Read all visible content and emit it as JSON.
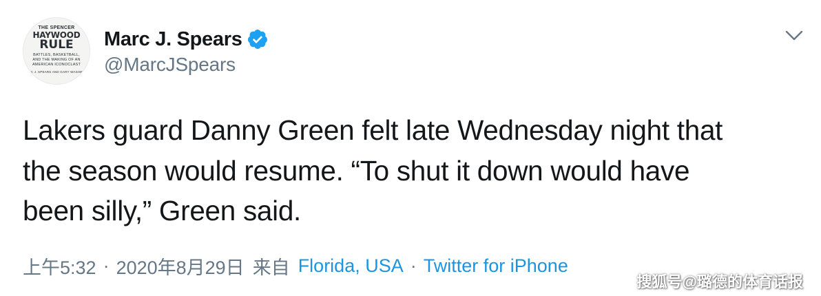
{
  "author": {
    "display_name": "Marc J. Spears",
    "handle": "@MarcJSpears",
    "verified": true,
    "avatar": {
      "line1": "THE SPENCER",
      "line2": "HAYWOOD",
      "line3": "RULE",
      "line4": "BATTLES, BASKETBALL,",
      "line5": "AND THE MAKING OF AN",
      "line6": "AMERICAN ICONOCLAST",
      "line7": "MARC J. SPEARS AND GARY WASHBURN"
    }
  },
  "tweet": {
    "line1": "Lakers guard Danny Green felt late Wednesday night that",
    "line2": "the season would resume. “To shut it down would have",
    "line3": "been silly,” Green said."
  },
  "meta": {
    "time": "上午5:32",
    "separator": "·",
    "date": "2020年8月29日",
    "from_label": "来自",
    "location": "Florida, USA",
    "source": "Twitter for iPhone"
  },
  "watermark": "搜狐号@璐德的体育话报",
  "icons": {
    "verified": "verified-badge-icon",
    "menu": "chevron-down-icon"
  },
  "colors": {
    "text_primary": "#14171a",
    "text_secondary": "#657786",
    "link": "#1b95e0",
    "verified": "#1da1f2"
  }
}
